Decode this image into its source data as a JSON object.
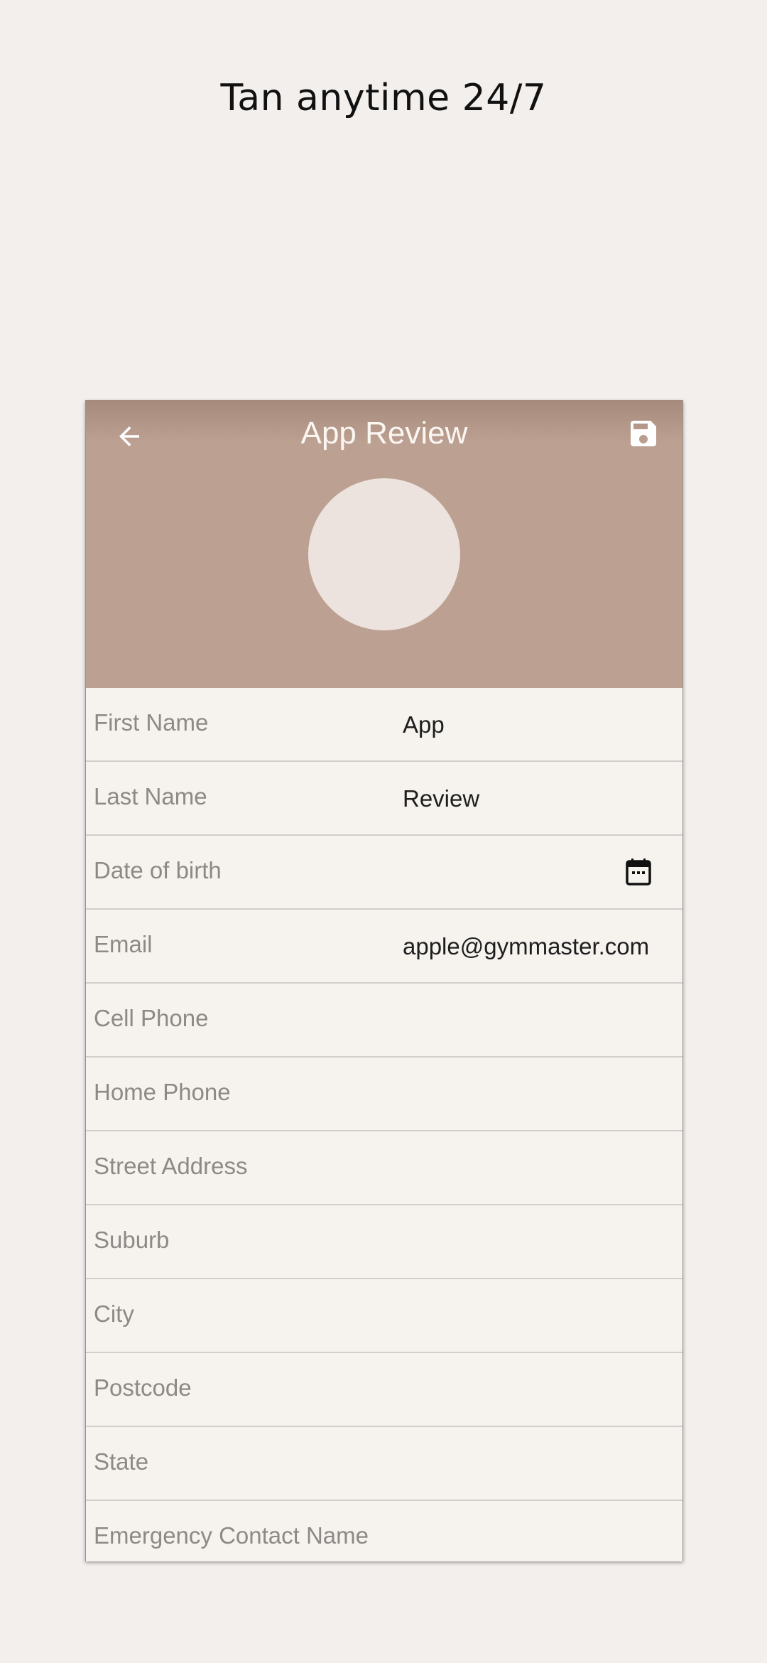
{
  "page": {
    "heading": "Tan anytime 24/7"
  },
  "app_bar": {
    "title": "App Review",
    "back_icon": "arrow-left-icon",
    "save_icon": "floppy-disk-icon"
  },
  "form": {
    "first_name": {
      "label": "First Name",
      "value": "App"
    },
    "last_name": {
      "label": "Last Name",
      "value": "Review"
    },
    "date_of_birth": {
      "label": "Date of birth",
      "value": "",
      "icon": "calendar-icon"
    },
    "email": {
      "label": "Email",
      "value": "apple@gymmaster.com"
    },
    "cell_phone": {
      "label": "Cell Phone",
      "value": ""
    },
    "home_phone": {
      "label": "Home Phone",
      "value": ""
    },
    "street_address": {
      "label": "Street Address",
      "value": ""
    },
    "suburb": {
      "label": "Suburb",
      "value": ""
    },
    "city": {
      "label": "City",
      "value": ""
    },
    "postcode": {
      "label": "Postcode",
      "value": ""
    },
    "state": {
      "label": "State",
      "value": ""
    },
    "emergency_contact_name": {
      "label": "Emergency Contact Name",
      "value": ""
    }
  },
  "colors": {
    "header_bg": "#bca091",
    "page_bg": "#f2efed",
    "form_bg": "#f6f3ef",
    "avatar_fill": "#ece3de",
    "label_text": "#8c8986",
    "value_text": "#1e1e1e"
  }
}
